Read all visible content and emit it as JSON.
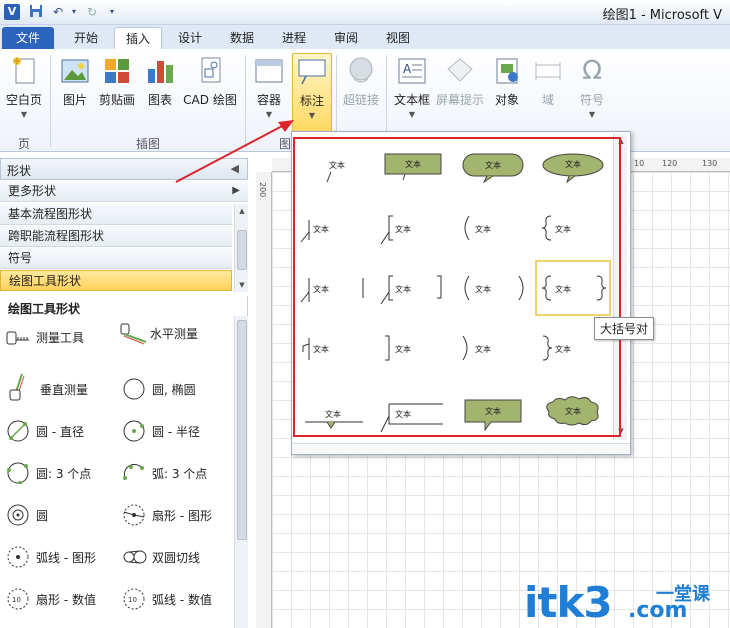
{
  "app": {
    "app_icon_letter": "V",
    "window_title": "绘图1 - Microsoft V"
  },
  "ribbon_tabs": [
    "文件",
    "开始",
    "插入",
    "设计",
    "数据",
    "进程",
    "审阅",
    "视图"
  ],
  "ribbon": {
    "buttons": {
      "blank_page": "空白页",
      "picture": "图片",
      "clipart": "剪贴画",
      "chart": "图表",
      "cad": "CAD 绘图",
      "container": "容器",
      "callout": "标注",
      "hyperlink": "超链接",
      "textbox": "文本框",
      "screentip": "屏幕提示",
      "object": "对象",
      "field": "域",
      "symbol": "符号"
    },
    "groups": {
      "pages": "页",
      "illustrations": "插图",
      "diagram_parts": "图"
    }
  },
  "shapes_panel": {
    "title": "形状",
    "more_shapes": "更多形状",
    "stencils": [
      "基本流程图形状",
      "跨职能流程图形状",
      "符号",
      "绘图工具形状"
    ],
    "tools_title": "绘图工具形状",
    "tools": [
      [
        "测量工具",
        "水平测量"
      ],
      [
        "垂直测量",
        "圆, 椭圆"
      ],
      [
        "圆 - 直径",
        "圆 - 半径"
      ],
      [
        "圆: 3 个点",
        "弧: 3 个点"
      ],
      [
        "圆",
        "扇形 - 图形"
      ],
      [
        "弧线 - 图形",
        "双圆切线"
      ],
      [
        "扇形 - 数值",
        "弧线 - 数值"
      ]
    ]
  },
  "ruler": {
    "top_marks": [
      "10",
      "120",
      "130"
    ],
    "left_mark": "200"
  },
  "callout_gallery": {
    "cell_text": "文本",
    "tooltip": "大括号对"
  },
  "watermark": {
    "text": "itk3",
    "sub": "一堂课",
    "domain": ".com"
  },
  "colors": {
    "accent_blue": "#2b63bd",
    "callout_green": "#a3b46e",
    "annotation_red": "#d9252b",
    "selection_yellow": "#ffd25a"
  }
}
